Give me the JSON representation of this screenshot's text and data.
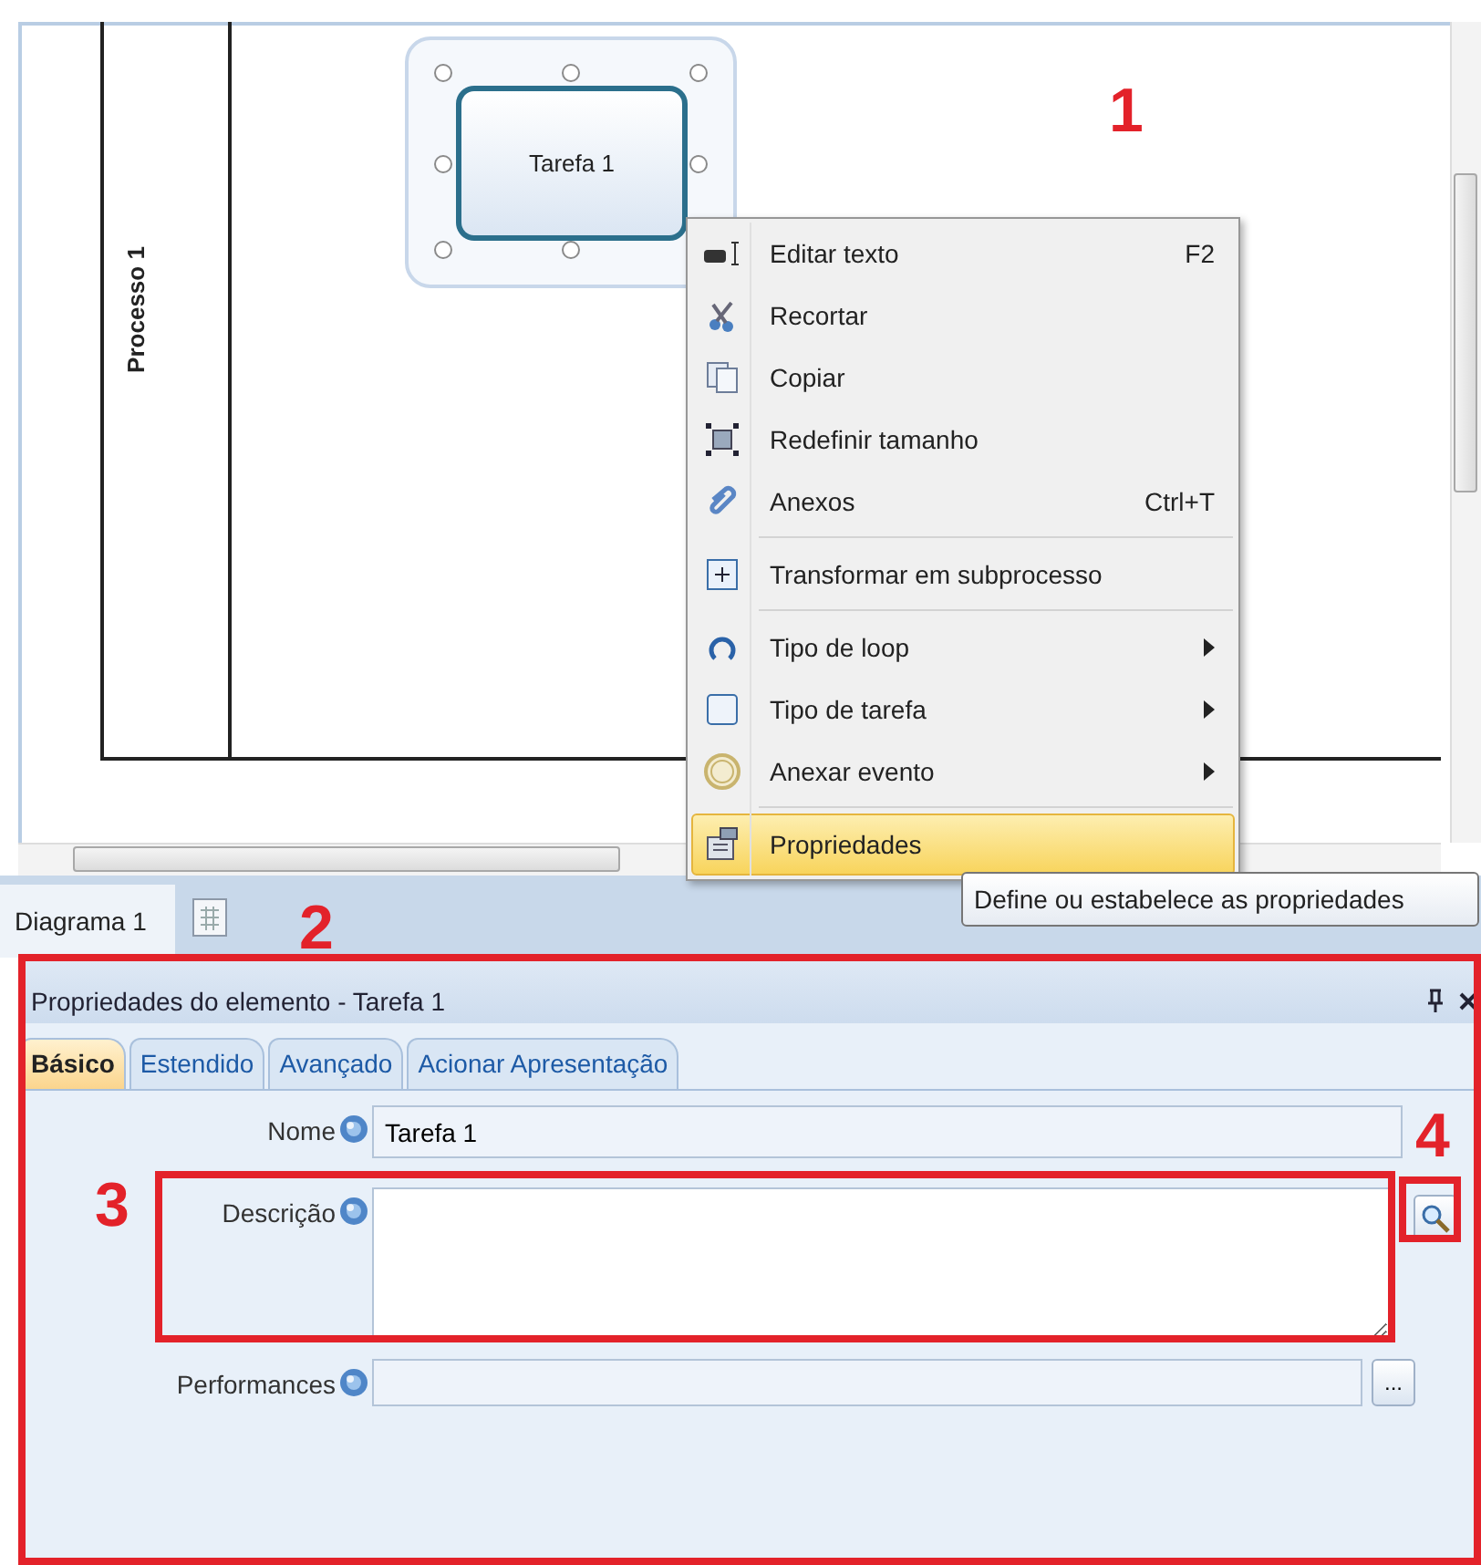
{
  "diagram": {
    "pool_label": "Processo 1",
    "task": {
      "label": "Tarefa 1",
      "selected": true
    }
  },
  "context_menu": {
    "items": [
      {
        "label": "Editar texto",
        "shortcut": "F2",
        "submenu": false,
        "highlighted": false,
        "separator_after": false
      },
      {
        "label": "Recortar",
        "submenu": false,
        "highlighted": false,
        "separator_after": false
      },
      {
        "label": "Copiar",
        "submenu": false,
        "highlighted": false,
        "separator_after": false
      },
      {
        "label": "Redefinir tamanho",
        "submenu": false,
        "highlighted": false,
        "separator_after": false
      },
      {
        "label": "Anexos",
        "shortcut": "Ctrl+T",
        "submenu": false,
        "highlighted": false,
        "separator_after": true
      },
      {
        "label": "Transformar em subprocesso",
        "submenu": false,
        "highlighted": false,
        "separator_after": true
      },
      {
        "label": "Tipo de loop",
        "submenu": true,
        "highlighted": false,
        "separator_after": false
      },
      {
        "label": "Tipo de tarefa",
        "submenu": true,
        "highlighted": false,
        "separator_after": false
      },
      {
        "label": "Anexar evento",
        "submenu": true,
        "highlighted": false,
        "separator_after": true
      },
      {
        "label": "Propriedades",
        "submenu": false,
        "highlighted": true,
        "separator_after": false
      }
    ]
  },
  "document_tabs": [
    {
      "label": "Diagrama 1",
      "selected": true
    }
  ],
  "tooltip": "Define ou estabelece as propriedades",
  "properties_panel": {
    "title": "Propriedades do elemento - Tarefa 1",
    "tabs": [
      {
        "label": "Básico",
        "selected": true
      },
      {
        "label": "Estendido",
        "selected": false
      },
      {
        "label": "Avançado",
        "selected": false
      },
      {
        "label": "Acionar Apresentação",
        "selected": false
      }
    ],
    "fields": [
      {
        "label": "Nome",
        "kind": "text",
        "value": "Tarefa 1"
      },
      {
        "label": "Descrição",
        "kind": "textarea"
      },
      {
        "label": "Performances",
        "kind": "picker",
        "button_label": "..."
      }
    ]
  },
  "callouts": [
    {
      "number": "1"
    },
    {
      "number": "2"
    },
    {
      "number": "3"
    },
    {
      "number": "4"
    }
  ]
}
